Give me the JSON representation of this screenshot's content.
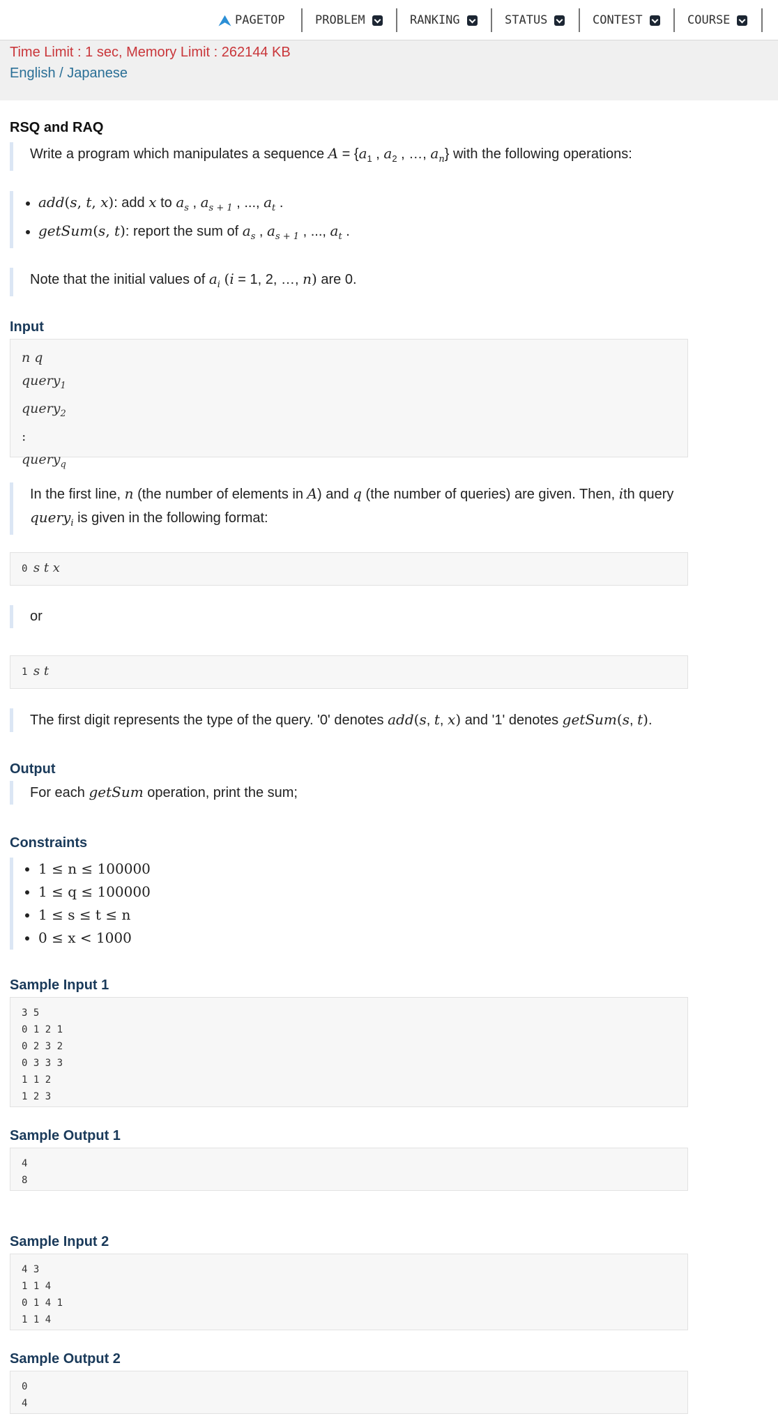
{
  "nav": {
    "items": [
      {
        "label": "PAGETOP",
        "dropdown": false
      },
      {
        "label": "PROBLEM",
        "dropdown": true
      },
      {
        "label": "RANKING",
        "dropdown": true
      },
      {
        "label": "STATUS",
        "dropdown": true
      },
      {
        "label": "CONTEST",
        "dropdown": true
      },
      {
        "label": "COURSE",
        "dropdown": true
      }
    ]
  },
  "header": {
    "limits": "Time Limit : 1 sec, Memory Limit : 262144 KB",
    "lang_en": "English",
    "lang_sep": "/",
    "lang_ja": "Japanese"
  },
  "problem": {
    "title": "RSQ and RAQ",
    "intro_pre": "Write a program which manipulates a sequence",
    "intro_post": "with the following operations:",
    "op_add_text": ": add",
    "op_add_to": "to",
    "op_getsum_text": ": report the sum of",
    "note_pre": "Note that the initial values of",
    "note_post": "are 0."
  },
  "sections": {
    "input": "Input",
    "output": "Output",
    "constraints": "Constraints",
    "sample_input_1": "Sample Input 1",
    "sample_output_1": "Sample Output 1",
    "sample_input_2": "Sample Input 2",
    "sample_output_2": "Sample Output 2"
  },
  "input_desc": {
    "line1_pre": "In the first line,",
    "line1_mid1": "(the number of elements in",
    "line1_mid2": ") and",
    "line1_mid3": "(the number of queries) are given. Then,",
    "line1_ith": "i",
    "line1_end": "th query",
    "line2_post": "is given in the following format:",
    "or": "or",
    "digit_desc_pre": "The first digit represents the type of the query. '0' denotes",
    "digit_desc_mid": "and '1' denotes",
    "digit_desc_end": "."
  },
  "output_desc": {
    "pre": "For each",
    "post": "operation, print the sum;"
  },
  "constraints": [
    "1 ≤ n ≤ 100000",
    "1 ≤ q ≤ 100000",
    "1 ≤ s ≤ t ≤ n",
    "0 ≤ x < 1000"
  ],
  "samples": {
    "input1": "3 5\n0 1 2 1\n0 2 3 2\n0 3 3 3\n1 1 2\n1 2 3",
    "output1": "4\n8",
    "input2": "4 3\n1 1 4\n0 1 4 1\n1 1 4",
    "output2": "0\n4"
  }
}
